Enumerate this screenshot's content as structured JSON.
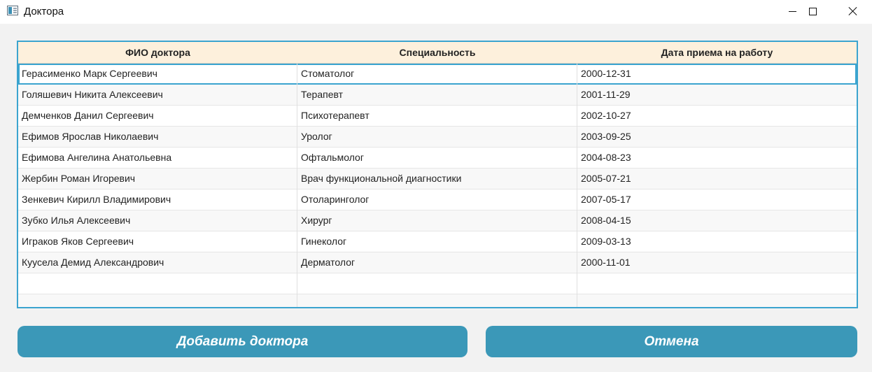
{
  "window": {
    "title": "Доктора"
  },
  "table": {
    "columns": [
      "ФИО доктора",
      "Специальность",
      "Дата приема на работу"
    ],
    "rows": [
      [
        "Герасименко Марк Сергеевич",
        "Стоматолог",
        "2000-12-31"
      ],
      [
        "Голяшевич Никита Алексеевич",
        "Терапевт",
        "2001-11-29"
      ],
      [
        "Демченков Данил Сергеевич",
        "Психотерапевт",
        "2002-10-27"
      ],
      [
        "Ефимов Ярослав Николаевич",
        "Уролог",
        "2003-09-25"
      ],
      [
        "Ефимова Ангелина Анатольевна",
        "Офтальмолог",
        "2004-08-23"
      ],
      [
        "Жербин Роман Игоревич",
        "Врач функциональной диагностики",
        "2005-07-21"
      ],
      [
        "Зенкевич Кирилл Владимирович",
        "Отоларинголог",
        "2007-05-17"
      ],
      [
        "Зубко Илья Алексеевич",
        "Хирург",
        "2008-04-15"
      ],
      [
        "Игракoв Яков Сергеевич",
        "Гинеколог",
        "2009-03-13"
      ],
      [
        "Куусела Демид Александрович",
        "Дерматолог",
        "2000-11-01"
      ]
    ],
    "selected_row": 0
  },
  "buttons": {
    "add_label": "Добавить доктора",
    "cancel_label": "Отмена"
  },
  "colors": {
    "accent": "#3ba4cf",
    "button": "#3b98b8",
    "header_bg": "#fdf0dc"
  },
  "icons": {
    "app": "app-window-icon",
    "minimize": "minimize-icon",
    "maximize": "maximize-icon",
    "close": "close-icon"
  }
}
